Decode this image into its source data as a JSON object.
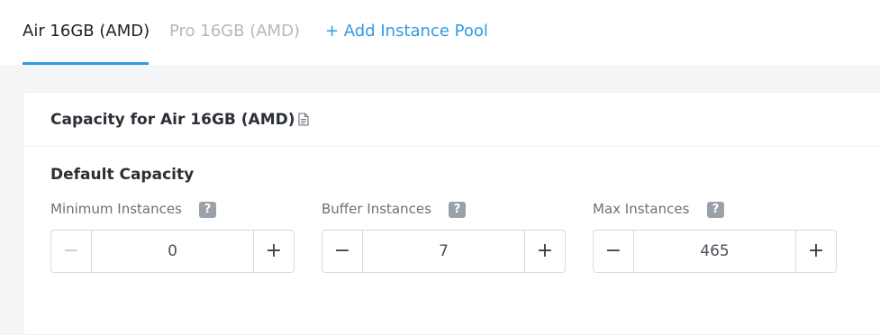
{
  "tabs": {
    "active_label": "Air 16GB (AMD)",
    "inactive_label": "Pro 16GB (AMD)",
    "add_label": "+ Add Instance Pool"
  },
  "card": {
    "title": "Capacity for Air 16GB (AMD)",
    "title_icon": "document-icon",
    "section_title": "Default Capacity",
    "fields": [
      {
        "label": "Minimum Instances",
        "help": "?",
        "value": "0",
        "minus": "−",
        "plus": "+",
        "minus_disabled": true
      },
      {
        "label": "Buffer Instances",
        "help": "?",
        "value": "7",
        "minus": "−",
        "plus": "+",
        "minus_disabled": false
      },
      {
        "label": "Max Instances",
        "help": "?",
        "value": "465",
        "minus": "−",
        "plus": "+",
        "minus_disabled": false
      }
    ]
  },
  "colors": {
    "accent": "#2f9be3",
    "help_badge": "#9aa1a9"
  }
}
